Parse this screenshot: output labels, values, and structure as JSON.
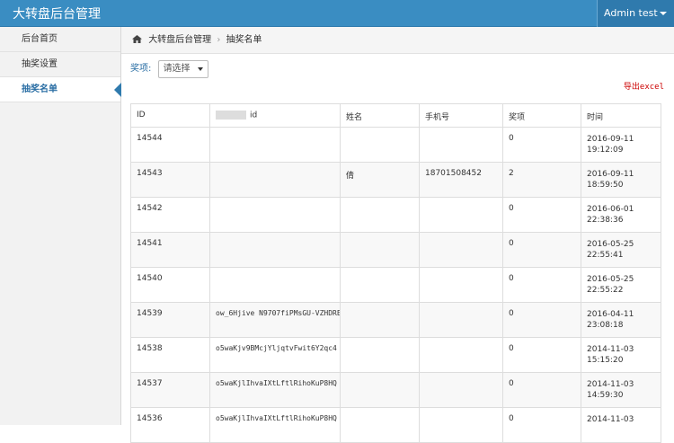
{
  "header": {
    "brand": "大转盘后台管理",
    "user": "Admin test"
  },
  "sidebar": {
    "items": [
      {
        "label": "后台首页"
      },
      {
        "label": "抽奖设置"
      },
      {
        "label": "抽奖名单"
      }
    ]
  },
  "breadcrumb": {
    "root": "大转盘后台管理",
    "current": "抽奖名单"
  },
  "filter": {
    "label": "奖项:",
    "selected": "请选择"
  },
  "export_label": "导出excel",
  "table": {
    "headers": [
      "ID",
      "id",
      "姓名",
      "手机号",
      "奖项",
      "时间"
    ],
    "rows": [
      {
        "id": "14544",
        "openid": "",
        "name": "",
        "phone": "",
        "prize": "0",
        "date": "2016-09-11",
        "time": "19:12:09"
      },
      {
        "id": "14543",
        "openid": "",
        "name": "倩",
        "phone": "18701508452",
        "prize": "2",
        "date": "2016-09-11",
        "time": "18:59:50"
      },
      {
        "id": "14542",
        "openid": "",
        "name": "",
        "phone": "",
        "prize": "0",
        "date": "2016-06-01",
        "time": "22:38:36"
      },
      {
        "id": "14541",
        "openid": "",
        "name": "",
        "phone": "",
        "prize": "0",
        "date": "2016-05-25",
        "time": "22:55:41"
      },
      {
        "id": "14540",
        "openid": "",
        "name": "",
        "phone": "",
        "prize": "0",
        "date": "2016-05-25",
        "time": "22:55:22"
      },
      {
        "id": "14539",
        "openid": "ow_6Hjive N9707fiPMsGU-VZHDRE",
        "name": "",
        "phone": "",
        "prize": "0",
        "date": "2016-04-11",
        "time": "23:08:18"
      },
      {
        "id": "14538",
        "openid": "o5waKjv9BMcjYljqtvFwit6Y2qc4",
        "name": "",
        "phone": "",
        "prize": "0",
        "date": "2014-11-03",
        "time": "15:15:20"
      },
      {
        "id": "14537",
        "openid": "o5waKjlIhvaIXtLftlRihoKuP8HQ",
        "name": "",
        "phone": "",
        "prize": "0",
        "date": "2014-11-03",
        "time": "14:59:30"
      },
      {
        "id": "14536",
        "openid": "o5waKjlIhvaIXtLftlRihoKuP8HQ",
        "name": "",
        "phone": "",
        "prize": "0",
        "date": "2014-11-03",
        "time": ""
      }
    ]
  }
}
